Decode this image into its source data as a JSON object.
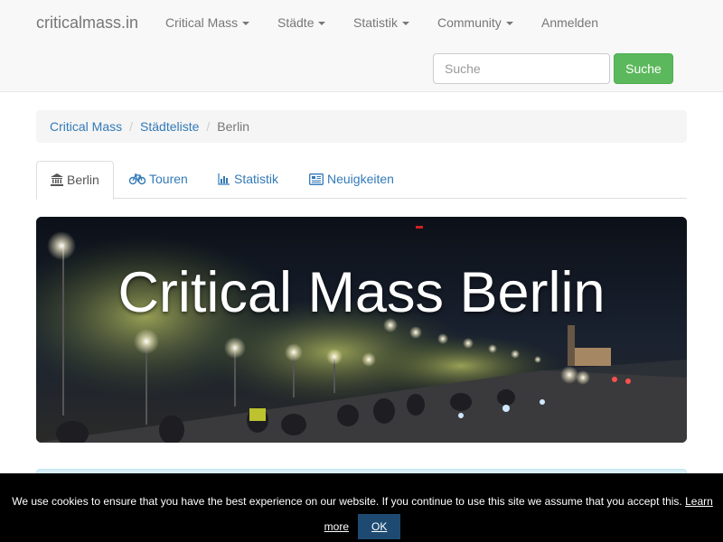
{
  "navbar": {
    "brand": "criticalmass.in",
    "items": [
      {
        "label": "Critical Mass",
        "dropdown": true
      },
      {
        "label": "Städte",
        "dropdown": true
      },
      {
        "label": "Statistik",
        "dropdown": true
      },
      {
        "label": "Community",
        "dropdown": true
      },
      {
        "label": "Anmelden",
        "dropdown": false
      }
    ],
    "search": {
      "placeholder": "Suche",
      "button": "Suche"
    }
  },
  "breadcrumb": {
    "items": [
      "Critical Mass",
      "Städteliste",
      "Berlin"
    ]
  },
  "tabs": [
    {
      "label": "Berlin",
      "icon": "bank-icon",
      "active": true
    },
    {
      "label": "Touren",
      "icon": "bicycle-icon",
      "active": false
    },
    {
      "label": "Statistik",
      "icon": "bar-chart-icon",
      "active": false
    },
    {
      "label": "Neuigkeiten",
      "icon": "newspaper-icon",
      "active": false
    }
  ],
  "hero": {
    "title": "Critical Mass Berlin"
  },
  "cookie": {
    "text": "We use cookies to ensure that you have the best experience on our website. If you continue to use this site we assume that you accept this.",
    "learn_more": "Learn more",
    "ok": "OK"
  },
  "colors": {
    "link": "#337ab7",
    "success": "#5cb85c",
    "navbar_bg": "#f8f8f8",
    "cookie_bg": "#000000",
    "cookie_button": "#1e4a72"
  }
}
